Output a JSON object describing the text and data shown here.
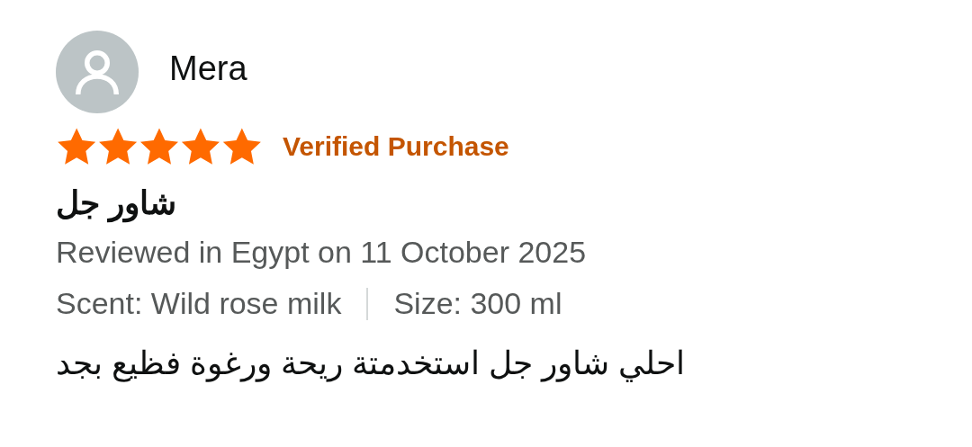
{
  "reviewer": {
    "name": "Mera"
  },
  "rating": {
    "stars": 5
  },
  "badge": "Verified Purchase",
  "title": "شاور جل",
  "meta": "Reviewed in Egypt on 11 October 2025",
  "variants": [
    "Scent: Wild rose milk",
    "Size: 300 ml"
  ],
  "body": "احلي شاور جل استخدمتة ريحة ورغوة فظيع بجد"
}
